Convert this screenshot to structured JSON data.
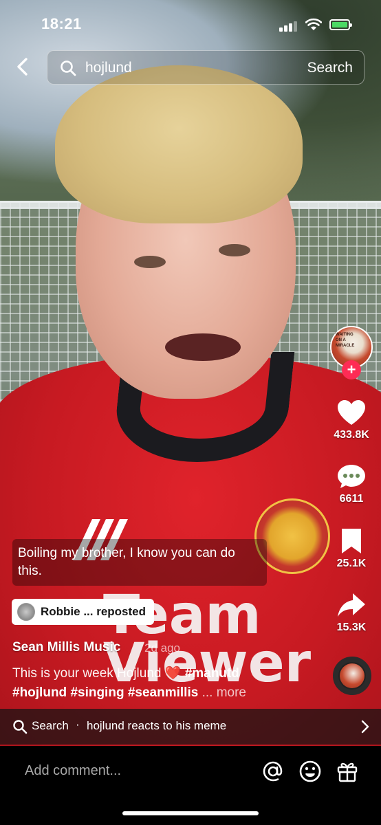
{
  "status_bar": {
    "time": "18:21"
  },
  "search": {
    "query": "hojlund",
    "button_label": "Search"
  },
  "creator": {
    "avatar_text": "WAITING ON A MIRACLE"
  },
  "actions": {
    "likes": "433.8K",
    "comments": "6611",
    "saves": "25.1K",
    "shares": "15.3K"
  },
  "video_caption": "Boiling my brother, I know you can do this.",
  "repost": {
    "label": "Robbie ... reposted"
  },
  "post": {
    "author": "Sean Millis Music",
    "ago": "2d ago",
    "description_text": "This is your week Hojlund",
    "emoji": "❤️",
    "hashtag1": "#manutd",
    "hashtag2": "#hojlund",
    "hashtag3": "#singing",
    "hashtag4": "#seanmillis",
    "more": "... more"
  },
  "search_suggestion": {
    "label": "Search",
    "separator": "·",
    "text": "hojlund reacts to his meme"
  },
  "comment_bar": {
    "placeholder": "Add comment..."
  },
  "background_video": {
    "sponsor_text": "Team Viewer"
  },
  "colors": {
    "accent": "#fe2c55",
    "battery": "#4bd964"
  },
  "icons": [
    "back-icon",
    "search-icon",
    "heart-icon",
    "comment-icon",
    "bookmark-icon",
    "share-icon",
    "chevron-right-icon",
    "at-icon",
    "emoji-icon",
    "gift-icon"
  ]
}
